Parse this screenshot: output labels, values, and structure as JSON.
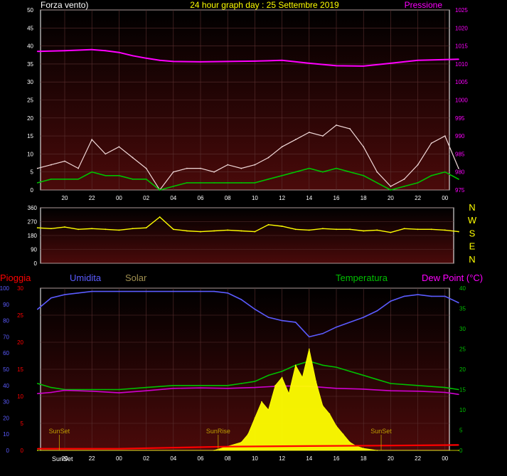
{
  "chart_data": [
    {
      "type": "line",
      "title": "24 hour graph day : 25 Settembre 2019",
      "left_label": "Forza vento)",
      "right_label": "Pressione",
      "y_left_ticks": [
        "0",
        "5",
        "10",
        "15",
        "20",
        "25",
        "30",
        "35",
        "40",
        "45",
        "50"
      ],
      "y_right_ticks": [
        "975",
        "980",
        "985",
        "990",
        "995",
        "1000",
        "1005",
        "1010",
        "1015",
        "1020",
        "1025"
      ],
      "x_ticks": [
        "20",
        "22",
        "00",
        "02",
        "04",
        "06",
        "08",
        "10",
        "12",
        "14",
        "16",
        "18",
        "20",
        "22",
        "00"
      ],
      "ylim": [
        0,
        50
      ],
      "ylim_right": [
        975,
        1025
      ],
      "colors": {
        "pressure": "#ff00ff",
        "gust": "#f0d8d8",
        "wind": "#00c000",
        "title": "#ffff00",
        "axis_label": "#ffffff"
      },
      "series": [
        {
          "role": "pressure",
          "axis": "right",
          "x": [
            18,
            20,
            22,
            23,
            24,
            1,
            2,
            3,
            4,
            6,
            8,
            10,
            12,
            14,
            16,
            18,
            20,
            22,
            24,
            25
          ],
          "y": [
            1013.5,
            1013.7,
            1014.0,
            1013.7,
            1013.2,
            1012.3,
            1011.6,
            1011.0,
            1010.7,
            1010.6,
            1010.7,
            1010.8,
            1011.0,
            1010.2,
            1009.5,
            1009.4,
            1010.2,
            1011.0,
            1011.2,
            1011.3
          ]
        },
        {
          "role": "gust",
          "axis": "left",
          "x": [
            18,
            19,
            20,
            21,
            22,
            23,
            24,
            1,
            2,
            3,
            4,
            5,
            6,
            7,
            8,
            9,
            10,
            11,
            12,
            13,
            14,
            15,
            16,
            17,
            18,
            19,
            20,
            21,
            22,
            23,
            24,
            25
          ],
          "y": [
            6,
            7,
            8,
            6,
            14,
            10,
            12,
            9,
            6,
            0,
            5,
            6,
            6,
            5,
            7,
            6,
            7,
            9,
            12,
            14,
            16,
            15,
            18,
            17,
            12,
            5,
            1,
            3,
            7,
            13,
            15,
            6
          ]
        },
        {
          "role": "wind",
          "axis": "left",
          "x": [
            18,
            19,
            20,
            21,
            22,
            23,
            24,
            1,
            2,
            3,
            4,
            5,
            6,
            7,
            8,
            9,
            10,
            11,
            12,
            13,
            14,
            15,
            16,
            17,
            18,
            19,
            20,
            21,
            22,
            23,
            24,
            25
          ],
          "y": [
            2,
            3,
            3,
            3,
            5,
            4,
            4,
            3,
            3,
            0,
            1,
            2,
            2,
            2,
            2,
            2,
            2,
            3,
            4,
            5,
            6,
            5,
            6,
            5,
            4,
            2,
            0,
            1,
            2,
            4,
            5,
            3
          ]
        }
      ]
    },
    {
      "type": "line",
      "y_ticks": [
        "0",
        "90",
        "180",
        "270",
        "360"
      ],
      "ylim": [
        0,
        360
      ],
      "compass": [
        "N",
        "W",
        "S",
        "E",
        "N"
      ],
      "colors": {
        "direction": "#ffff00",
        "compass": "#ffff00"
      },
      "series": [
        {
          "role": "direction",
          "x": [
            18,
            19,
            20,
            21,
            22,
            23,
            24,
            1,
            2,
            3,
            4,
            5,
            6,
            7,
            8,
            9,
            10,
            11,
            12,
            13,
            14,
            15,
            16,
            17,
            18,
            19,
            20,
            21,
            22,
            23,
            24,
            25
          ],
          "y": [
            230,
            225,
            235,
            220,
            225,
            220,
            215,
            225,
            230,
            300,
            220,
            210,
            205,
            210,
            215,
            210,
            205,
            250,
            240,
            220,
            215,
            225,
            220,
            220,
            210,
            215,
            200,
            225,
            220,
            220,
            215,
            205
          ]
        }
      ]
    },
    {
      "type": "area",
      "labels": {
        "rain": "Pioggia",
        "humidity": "Umidita",
        "solar": "Solar",
        "temperature": "Temperatura",
        "dewpoint": "Dew Point (°C)"
      },
      "y_left_ticks": [
        "0",
        "10",
        "20",
        "30",
        "40",
        "50",
        "60",
        "70",
        "80",
        "90",
        "100"
      ],
      "y_left2_ticks": [
        "0",
        "5",
        "10",
        "15",
        "20",
        "25",
        "30"
      ],
      "y_right_ticks": [
        "0",
        "5",
        "10",
        "15",
        "20",
        "25",
        "30",
        "35",
        "40"
      ],
      "x_ticks": [
        "20",
        "22",
        "00",
        "02",
        "04",
        "06",
        "08",
        "10",
        "12",
        "14",
        "16",
        "18",
        "20",
        "22",
        "00"
      ],
      "bottom_extra": "SunSet",
      "annotations": [
        {
          "text": "SunSet",
          "x": 19.1
        },
        {
          "text": "SunRise",
          "x": 7.3
        },
        {
          "text": "SunSet",
          "x": 19.3
        }
      ],
      "colors": {
        "rain": "#ff0000",
        "humidity": "#5b5bff",
        "solar": "#ffff00",
        "solar_label": "#a09050",
        "temperature": "#00c000",
        "dewpoint": "#d000d0",
        "sun": "#c0a000"
      },
      "series": [
        {
          "role": "humidity",
          "axis": "left",
          "x": [
            18,
            19,
            20,
            21,
            22,
            24,
            2,
            4,
            6,
            7,
            8,
            9,
            10,
            11,
            12,
            13,
            14,
            15,
            16,
            17,
            18,
            19,
            20,
            21,
            22,
            23,
            24,
            25
          ],
          "y": [
            87,
            94,
            96,
            97,
            98,
            98,
            98,
            98,
            98,
            98,
            97,
            93,
            87,
            82,
            80,
            79,
            70,
            72,
            76,
            79,
            82,
            86,
            92,
            95,
            96,
            95,
            95,
            91
          ]
        },
        {
          "role": "temperature",
          "axis": "right",
          "x": [
            18,
            19,
            20,
            22,
            24,
            2,
            4,
            6,
            8,
            9,
            10,
            11,
            12,
            13,
            14,
            15,
            16,
            17,
            18,
            19,
            20,
            22,
            24,
            25
          ],
          "y": [
            16.5,
            15.5,
            15.0,
            15.0,
            15.0,
            15.5,
            16.0,
            16.0,
            16.0,
            16.5,
            17.0,
            18.5,
            19.5,
            21.0,
            22.0,
            21.0,
            20.5,
            19.5,
            18.5,
            17.5,
            16.5,
            16.0,
            15.5,
            15.0
          ]
        },
        {
          "role": "dewpoint",
          "axis": "right",
          "x": [
            18,
            19,
            20,
            22,
            24,
            2,
            4,
            6,
            8,
            10,
            12,
            14,
            16,
            18,
            20,
            22,
            24,
            25
          ],
          "y": [
            14.0,
            14.3,
            14.8,
            14.6,
            14.2,
            14.7,
            15.3,
            15.4,
            15.3,
            15.5,
            15.9,
            15.8,
            15.3,
            15.1,
            14.7,
            14.6,
            14.3,
            13.8
          ]
        },
        {
          "role": "solar",
          "axis": "right",
          "x": [
            18,
            7,
            8,
            9,
            9.5,
            10,
            10.5,
            11,
            11.5,
            12,
            12.5,
            13,
            13.5,
            14,
            14.5,
            15,
            15.5,
            16,
            16.5,
            17,
            17.5,
            18,
            19,
            25
          ],
          "y": [
            0,
            0,
            1,
            2,
            4,
            8,
            12,
            10,
            16,
            18,
            14,
            21,
            18,
            25,
            17,
            11,
            9,
            6,
            4,
            2,
            1,
            0.5,
            0,
            0
          ]
        },
        {
          "role": "rain",
          "axis": "left2",
          "x": [
            18,
            24,
            4,
            8,
            14,
            20,
            25
          ],
          "y": [
            0.3,
            0.3,
            0.5,
            0.7,
            0.8,
            0.9,
            1.0
          ]
        }
      ]
    }
  ]
}
